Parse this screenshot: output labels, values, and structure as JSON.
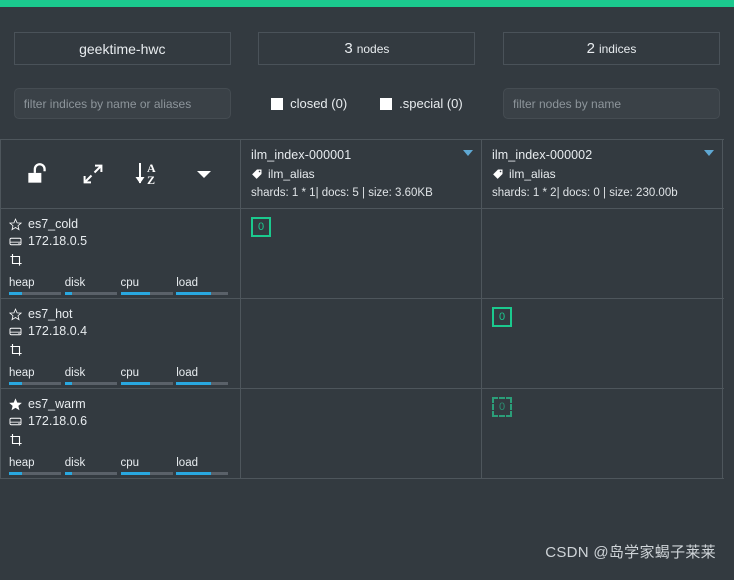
{
  "topbar": {
    "color": "#1bc98e"
  },
  "header": {
    "cluster_name": "geektime-hwc",
    "nodes_count": "3",
    "nodes_label": "nodes",
    "indices_count": "2",
    "indices_label": "indices",
    "indices_filter_placeholder": "filter indices by name or aliases",
    "nodes_filter_placeholder": "filter nodes by name",
    "indices_filter_value": "",
    "nodes_filter_value": "",
    "checkboxes": [
      {
        "label": "closed (0)",
        "checked": false,
        "name": "closed"
      },
      {
        "label": ".special (0)",
        "checked": false,
        "name": "special"
      }
    ]
  },
  "toolbar": {
    "icons": [
      {
        "name": "unlock-icon",
        "title": "unlock"
      },
      {
        "name": "expand-arrows-icon",
        "title": "expand"
      },
      {
        "name": "sort-az-icon",
        "title": "sort A-Z"
      },
      {
        "name": "chevron-down-icon",
        "title": "more"
      }
    ]
  },
  "indices": [
    {
      "name": "ilm_index-000001",
      "alias": "ilm_alias",
      "stats": "shards: 1 * 1| docs: 5 | size: 3.60KB",
      "shards": "1 * 1",
      "docs": "5",
      "size": "3.60KB"
    },
    {
      "name": "ilm_index-000002",
      "alias": "ilm_alias",
      "stats": "shards: 1 * 2| docs: 0 | size: 230.00b",
      "shards": "1 * 2",
      "docs": "0",
      "size": "230.00b"
    }
  ],
  "nodes": [
    {
      "name": "es7_cold",
      "ip": "172.18.0.5",
      "master": false,
      "metrics": [
        {
          "label": "heap",
          "pct": 25
        },
        {
          "label": "disk",
          "pct": 13
        },
        {
          "label": "cpu",
          "pct": 56
        },
        {
          "label": "load",
          "pct": 66
        }
      ],
      "shards": [
        {
          "index": "ilm_index-000001",
          "num": "0",
          "type": "primary"
        },
        {
          "index": "ilm_index-000002",
          "num": null,
          "type": null
        }
      ]
    },
    {
      "name": "es7_hot",
      "ip": "172.18.0.4",
      "master": false,
      "metrics": [
        {
          "label": "heap",
          "pct": 25
        },
        {
          "label": "disk",
          "pct": 13
        },
        {
          "label": "cpu",
          "pct": 56
        },
        {
          "label": "load",
          "pct": 66
        }
      ],
      "shards": [
        {
          "index": "ilm_index-000001",
          "num": null,
          "type": null
        },
        {
          "index": "ilm_index-000002",
          "num": "0",
          "type": "primary"
        }
      ]
    },
    {
      "name": "es7_warm",
      "ip": "172.18.0.6",
      "master": true,
      "metrics": [
        {
          "label": "heap",
          "pct": 25
        },
        {
          "label": "disk",
          "pct": 13
        },
        {
          "label": "cpu",
          "pct": 56
        },
        {
          "label": "load",
          "pct": 66
        }
      ],
      "shards": [
        {
          "index": "ilm_index-000001",
          "num": null,
          "type": null
        },
        {
          "index": "ilm_index-000002",
          "num": "0",
          "type": "replica"
        }
      ]
    }
  ],
  "watermark": "CSDN @岛学家蝎子莱莱",
  "colors": {
    "accent": "#1bc98e",
    "background": "#333a40",
    "border": "#4e565c",
    "metric_bar": "#29a8e0",
    "shard_primary": "#1bc98e",
    "shard_replica": "#2b9e79"
  }
}
